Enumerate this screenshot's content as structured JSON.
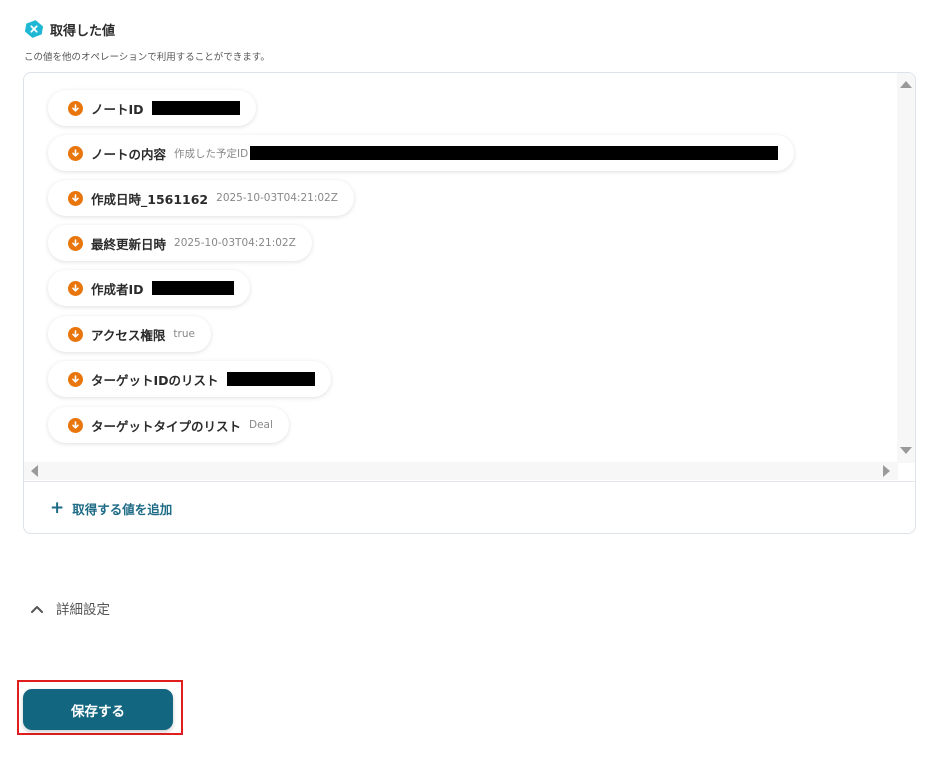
{
  "section": {
    "title": "取得した値",
    "description": "この値を他のオペレーションで利用することができます。",
    "icon": "x-hexagon-icon"
  },
  "values": [
    {
      "label": "ノートID",
      "value": "",
      "redacted": true
    },
    {
      "label": "ノートの内容",
      "value": "作成した予定ID",
      "redacted": true
    },
    {
      "label": "作成日時_1561162",
      "value": "2025-10-03T04:21:02Z",
      "redacted": false
    },
    {
      "label": "最終更新日時",
      "value": "2025-10-03T04:21:02Z",
      "redacted": false
    },
    {
      "label": "作成者ID",
      "value": "",
      "redacted": true
    },
    {
      "label": "アクセス権限",
      "value": "true",
      "redacted": false
    },
    {
      "label": "ターゲットIDのリスト",
      "value": "",
      "redacted": true
    },
    {
      "label": "ターゲットタイプのリスト",
      "value": "Deal",
      "redacted": false
    }
  ],
  "add_button": {
    "label": "取得する値を追加"
  },
  "advanced": {
    "label": "詳細設定"
  },
  "save_button": {
    "label": "保存する"
  },
  "colors": {
    "accent": "#136680",
    "chip_icon": "#e8760d",
    "section_icon": "#1fb8d4",
    "highlight": "#e01e1e"
  }
}
